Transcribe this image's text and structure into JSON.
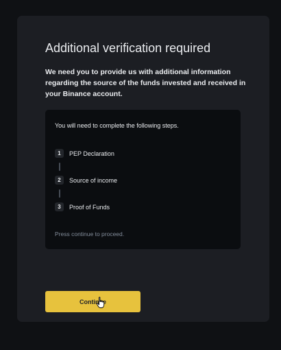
{
  "dialog": {
    "title": "Additional verification required",
    "description": "We need you to provide us with additional information regarding the source of the funds invested and received in your Binance account."
  },
  "steps_panel": {
    "intro": "You will need to complete the following steps.",
    "steps": [
      {
        "number": "1",
        "label": "PEP Declaration"
      },
      {
        "number": "2",
        "label": "Source of income"
      },
      {
        "number": "3",
        "label": "Proof of Funds"
      }
    ],
    "note": "Press continue to proceed."
  },
  "actions": {
    "continue_label": "Continue"
  },
  "colors": {
    "background": "#0f1114",
    "card": "#1c1e23",
    "panel": "#0b0d10",
    "accent": "#e7c23d",
    "text_primary": "#eaecef",
    "text_muted": "#848e9c"
  },
  "cursor_icon": "hand-pointer-icon"
}
